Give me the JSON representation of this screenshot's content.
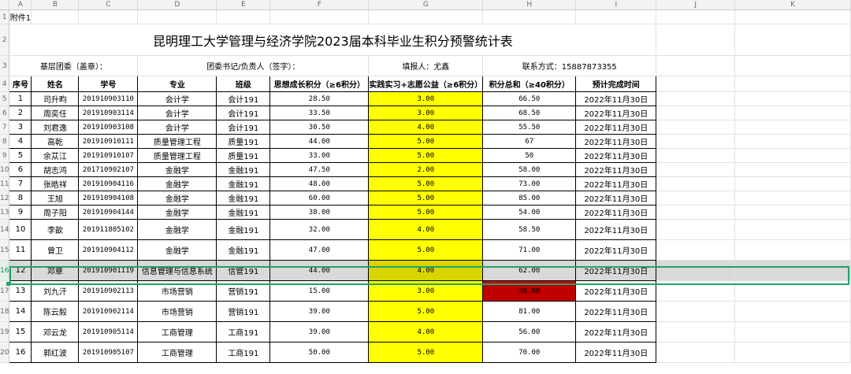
{
  "col_letters": [
    "A",
    "B",
    "C",
    "D",
    "E",
    "F",
    "G",
    "H",
    "I",
    "J",
    "K"
  ],
  "row_numbers": [
    "1",
    "2",
    "3",
    "4",
    "5",
    "6",
    "7",
    "8",
    "9",
    "10",
    "11",
    "12",
    "13",
    "14",
    "15",
    "16",
    "17",
    "18",
    "19",
    "20"
  ],
  "annex": "附件1",
  "title": "昆明理工大学管理与经济学院2023届本科毕业生积分预警统计表",
  "info": {
    "org": "基层团委（盖章）：",
    "secretary": "团委书记/负责人（签字）：",
    "filler": "填报人：尤鑫",
    "contact": "联系方式：15887873355"
  },
  "headers": [
    "序号",
    "姓名",
    "学号",
    "专业",
    "班级",
    "思想成长积分（≥6积分）",
    "实践实习+志愿公益（≥6积分）",
    "积分总和（≥40积分）",
    "预计完成时间"
  ],
  "rows": [
    {
      "no": "1",
      "name": "司升畇",
      "id": "201910903110",
      "major": "会计学",
      "cls": "会计191",
      "f": "28.50",
      "g": "3.00",
      "h": "66.50",
      "i": "2022年11月30日"
    },
    {
      "no": "2",
      "name": "周奕任",
      "id": "201910903114",
      "major": "会计学",
      "cls": "会计191",
      "f": "33.50",
      "g": "3.00",
      "h": "68.50",
      "i": "2022年11月30日"
    },
    {
      "no": "3",
      "name": "刘君逸",
      "id": "201910903108",
      "major": "会计学",
      "cls": "会计191",
      "f": "30.50",
      "g": "4.00",
      "h": "55.50",
      "i": "2022年11月30日"
    },
    {
      "no": "4",
      "name": "高乾",
      "id": "201910910111",
      "major": "质量管理工程",
      "cls": "质量191",
      "f": "44.00",
      "g": "5.00",
      "h": "67",
      "i": "2022年11月30日"
    },
    {
      "no": "5",
      "name": "余苁江",
      "id": "201910910107",
      "major": "质量管理工程",
      "cls": "质量191",
      "f": "33.00",
      "g": "5.00",
      "h": "50",
      "i": "2022年11月30日"
    },
    {
      "no": "6",
      "name": "胡志鸿",
      "id": "201710902107",
      "major": "金融学",
      "cls": "金融191",
      "f": "47.50",
      "g": "2.00",
      "h": "58.00",
      "i": "2022年11月30日"
    },
    {
      "no": "7",
      "name": "张皓祥",
      "id": "201910904116",
      "major": "金融学",
      "cls": "金融191",
      "f": "48.00",
      "g": "5.00",
      "h": "73.00",
      "i": "2022年11月30日"
    },
    {
      "no": "8",
      "name": "王旭",
      "id": "201910904108",
      "major": "金融学",
      "cls": "金融191",
      "f": "60.00",
      "g": "5.00",
      "h": "85.00",
      "i": "2022年11月30日"
    },
    {
      "no": "9",
      "name": "周子阳",
      "id": "201910904144",
      "major": "金融学",
      "cls": "金融191",
      "f": "38.00",
      "g": "5.00",
      "h": "54.00",
      "i": "2022年11月30日"
    },
    {
      "no": "10",
      "name": "李歆",
      "id": "201911805102",
      "major": "金融学",
      "cls": "金融191",
      "f": "32.00",
      "g": "4.00",
      "h": "58.50",
      "i": "2022年11月30日"
    },
    {
      "no": "11",
      "name": "曾卫",
      "id": "201910904112",
      "major": "金融学",
      "cls": "金融191",
      "f": "47.00",
      "g": "5.00",
      "h": "71.00",
      "i": "2022年11月30日"
    },
    {
      "no": "12",
      "name": "邓章",
      "id": "201910901119",
      "major": "信息管理与信息系统",
      "cls": "信管191",
      "f": "44.00",
      "g": "4.00",
      "h": "62.00",
      "i": "2022年11月30日"
    },
    {
      "no": "13",
      "name": "刘九汗",
      "id": "201910902113",
      "major": "市场营销",
      "cls": "营销191",
      "f": "15.00",
      "g": "3.00",
      "h": "38.00",
      "i": "2022年11月30日"
    },
    {
      "no": "14",
      "name": "陈云毅",
      "id": "201910902114",
      "major": "市场营销",
      "cls": "营销191",
      "f": "39.00",
      "g": "5.00",
      "h": "81.00",
      "i": "2022年11月30日"
    },
    {
      "no": "15",
      "name": "邓云龙",
      "id": "201910905114",
      "major": "工商管理",
      "cls": "工商191",
      "f": "39.00",
      "g": "4.00",
      "h": "56.00",
      "i": "2022年11月30日"
    },
    {
      "no": "16",
      "name": "郭红波",
      "id": "201910905107",
      "major": "工商管理",
      "cls": "工商191",
      "f": "50.00",
      "g": "5.00",
      "h": "70.00",
      "i": "2022年11月30日"
    }
  ],
  "colors": {
    "highlight_yellow": "#ffff00",
    "alert_red": "#c00000",
    "selection_green": "#21a366",
    "selected_row_gray": "#d9d9d9"
  }
}
